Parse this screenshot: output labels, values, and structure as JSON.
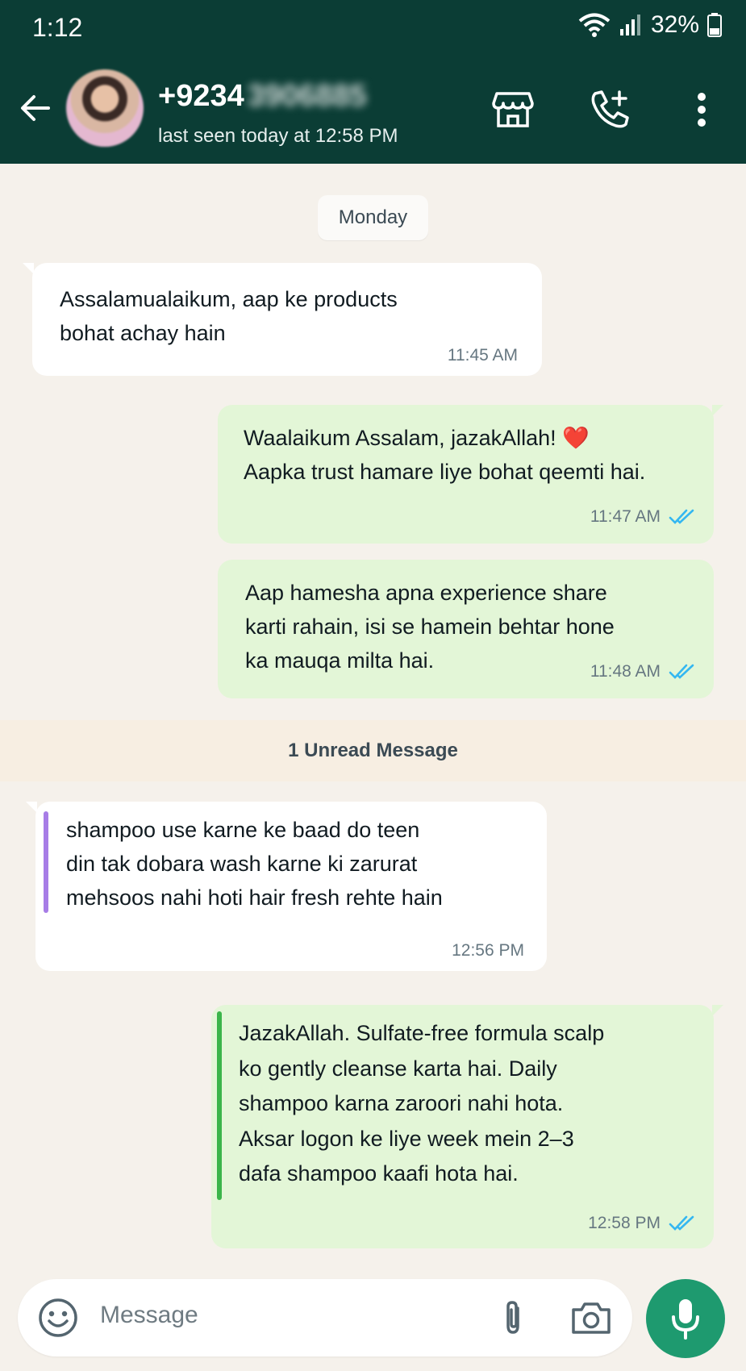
{
  "status_bar": {
    "time": "1:12",
    "battery": "32%"
  },
  "header": {
    "contact_prefix": "+9234",
    "contact_hidden": "3906885",
    "last_seen": "last seen today at 12:58 PM"
  },
  "chat": {
    "date_chip": "Monday",
    "messages": [
      {
        "direction": "in",
        "text": "Assalamualaikum, aap ke products\nbohat achay hain",
        "time": "11:45 AM"
      },
      {
        "direction": "out",
        "text": "Waalaikum Assalam, jazakAllah! ❤️\nAapka trust hamare liye bohat qeemti hai.",
        "time": "11:47 AM"
      },
      {
        "direction": "out",
        "text": "Aap hamesha apna experience share\nkarti rahain, isi se hamein behtar hone\nka mauqa milta hai.",
        "time": "11:48 AM"
      },
      {
        "direction": "in",
        "text": "shampoo use karne ke baad do teen\ndin tak dobara wash karne ki zarurat\nmehsoos nahi hoti hair fresh rehte hain",
        "time": "12:56 PM"
      },
      {
        "direction": "out",
        "text": "JazakAllah. Sulfate-free formula scalp\nko gently cleanse karta hai. Daily\nshampoo karna zaroori nahi hota.\nAksar logon ke liye week mein 2–3\ndafa shampoo kaafi hota hai.",
        "time": "12:58 PM"
      }
    ],
    "unread_banner": "1 Unread Message"
  },
  "composer": {
    "placeholder": "Message"
  },
  "colors": {
    "header": "#0b3d35",
    "outgoing": "#e3f6d7",
    "incoming": "#ffffff",
    "tick": "#34b7f1",
    "mic": "#1e9a6f",
    "quote_in": "#a77de6",
    "quote_out": "#3bb54a"
  }
}
